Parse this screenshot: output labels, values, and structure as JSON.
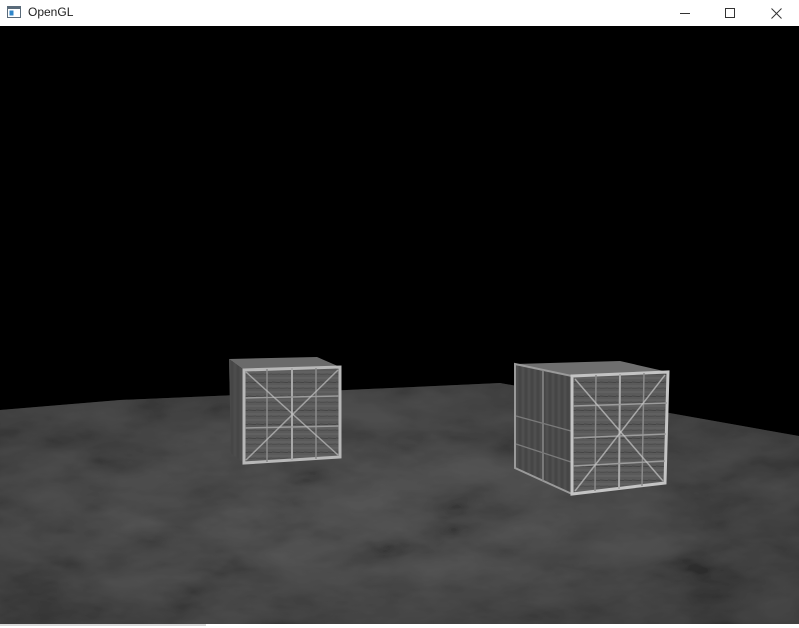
{
  "window": {
    "title": "OpenGL",
    "app_icon": "opengl-window-icon",
    "controls": {
      "minimize_icon": "minimize-icon",
      "maximize_icon": "maximize-icon",
      "close_icon": "close-icon"
    }
  },
  "scene": {
    "background_color": "#000000",
    "floor_color": "#4a4a4a",
    "objects": [
      {
        "name": "wooden-crate-left",
        "texture": "crate-wood-planks"
      },
      {
        "name": "wooden-crate-right",
        "texture": "crate-wood-planks"
      }
    ]
  }
}
